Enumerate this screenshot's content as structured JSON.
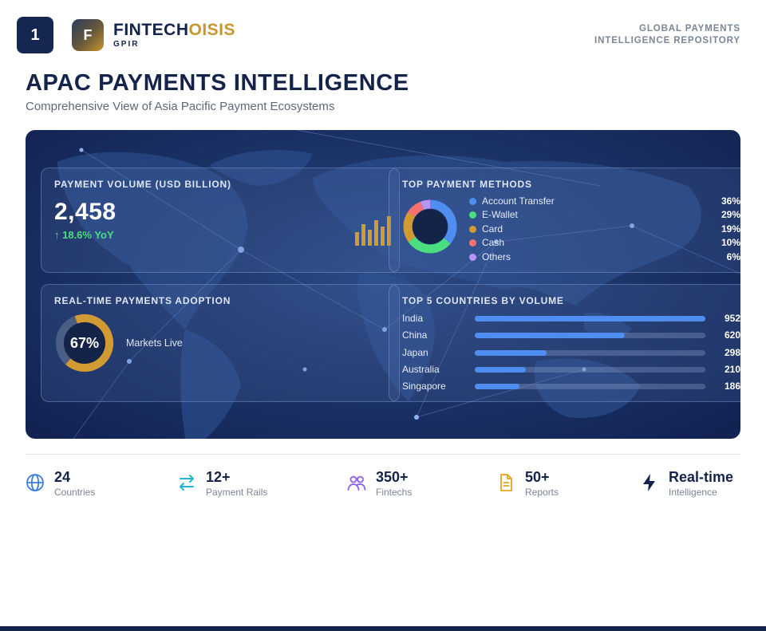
{
  "header": {
    "page_number": "1",
    "logo_letter": "F",
    "brand_primary": "FINTECH",
    "brand_accent": "OISIS",
    "brand_sub": "GPIR",
    "repo_line1": "GLOBAL PAYMENTS",
    "repo_line2": "INTELLIGENCE REPOSITORY"
  },
  "title": "APAC PAYMENTS INTELLIGENCE",
  "subtitle": "Comprehensive View of Asia Pacific Payment Ecosystems",
  "volume": {
    "label": "PAYMENT VOLUME (USD BILLION)",
    "value": "2,458",
    "change": "↑ 18.6% YoY"
  },
  "methods": {
    "label": "TOP PAYMENT METHODS",
    "items": [
      {
        "name": "Account Transfer",
        "pct": "36%",
        "share": 36,
        "color": "#4f8ef0"
      },
      {
        "name": "E-Wallet",
        "pct": "29%",
        "share": 29,
        "color": "#4ade80"
      },
      {
        "name": "Card",
        "pct": "19%",
        "share": 19,
        "color": "#d29a32"
      },
      {
        "name": "Cash",
        "pct": "10%",
        "share": 10,
        "color": "#f87171"
      },
      {
        "name": "Others",
        "pct": "6%",
        "share": 6,
        "color": "#b794f6"
      }
    ]
  },
  "adoption": {
    "label": "REAL-TIME PAYMENTS ADOPTION",
    "value": "67%",
    "fraction": 0.67,
    "caption": "Markets Live"
  },
  "countries": {
    "label": "TOP 5 COUNTRIES BY VOLUME",
    "items": [
      {
        "name": "India",
        "value": "952",
        "amount": 952
      },
      {
        "name": "China",
        "value": "620",
        "amount": 620
      },
      {
        "name": "Japan",
        "value": "298",
        "amount": 298
      },
      {
        "name": "Australia",
        "value": "210",
        "amount": 210
      },
      {
        "name": "Singapore",
        "value": "186",
        "amount": 186
      }
    ]
  },
  "stats": [
    {
      "value": "24",
      "label": "Countries",
      "icon": "globe-icon"
    },
    {
      "value": "12+",
      "label": "Payment Rails",
      "icon": "transfer-arrows-icon"
    },
    {
      "value": "350+",
      "label": "Fintechs",
      "icon": "users-icon"
    },
    {
      "value": "50+",
      "label": "Reports",
      "icon": "document-icon"
    },
    {
      "value": "Real-time",
      "label": "Intelligence",
      "icon": "lightning-icon"
    }
  ],
  "colors": {
    "navy": "#13234a",
    "gold": "#c8962f",
    "ring_gold": "#d29a32",
    "positive": "#4ade80"
  }
}
